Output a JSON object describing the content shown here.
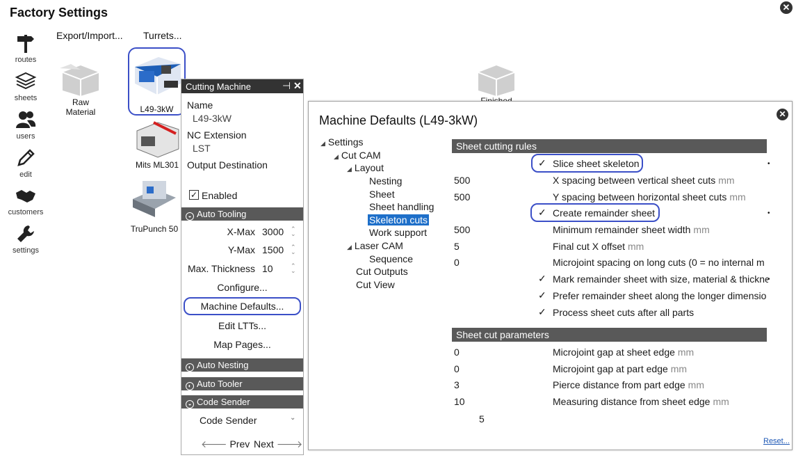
{
  "app": {
    "title": "Factory Settings",
    "close_icon": "close-icon"
  },
  "toplinks": {
    "export": "Export/Import...",
    "turrets": "Turrets..."
  },
  "nav": [
    {
      "label": "routes",
      "icon": "signpost-icon"
    },
    {
      "label": "sheets",
      "icon": "layers-icon"
    },
    {
      "label": "users",
      "icon": "users-icon"
    },
    {
      "label": "edit",
      "icon": "pencil-icon"
    },
    {
      "label": "customers",
      "icon": "handshake-icon"
    },
    {
      "label": "settings",
      "icon": "wrench-icon"
    }
  ],
  "canvas": {
    "raw_material": "Raw\nMaterial",
    "l49": "L49-3kW",
    "mits": "Mits ML301",
    "trupunch": "TruPunch 50",
    "finished": "Finished"
  },
  "panel": {
    "title": "Cutting Machine",
    "name_label": "Name",
    "name_value": "L49-3kW",
    "nc_label": "NC Extension",
    "nc_value": "LST",
    "output_label": "Output Destination",
    "enabled_label": "Enabled",
    "enabled": true,
    "auto_tooling": "Auto Tooling",
    "xmax_label": "X-Max",
    "xmax_value": "3000",
    "ymax_label": "Y-Max",
    "ymax_value": "1500",
    "thick_label": "Max. Thickness",
    "thick_value": "10",
    "configure": "Configure...",
    "machine_defaults": "Machine Defaults...",
    "edit_ltts": "Edit LTTs...",
    "map_pages": "Map Pages...",
    "auto_nesting": "Auto Nesting",
    "auto_tooler": "Auto Tooler",
    "code_sender_section": "Code Sender",
    "code_sender_select": "Code Sender",
    "prev": "Prev",
    "next": "Next"
  },
  "dialog": {
    "title": "Machine Defaults (L49-3kW)",
    "tree": [
      {
        "label": "Settings",
        "expander": "◢"
      },
      {
        "label": "Cut CAM",
        "expander": "◢"
      },
      {
        "label": "Layout",
        "expander": "◢"
      },
      {
        "label": "Nesting"
      },
      {
        "label": "Sheet"
      },
      {
        "label": "Sheet handling"
      },
      {
        "label": "Skeleton cuts",
        "selected": true
      },
      {
        "label": "Work support"
      },
      {
        "label": "Laser CAM",
        "expander": "◢"
      },
      {
        "label": "Sequence"
      },
      {
        "label": "Cut Outputs"
      },
      {
        "label": "Cut View"
      }
    ],
    "section1": "Sheet cutting rules",
    "rules": [
      {
        "value": "",
        "check": "✓",
        "label": "Slice sheet skeleton",
        "unit": ""
      },
      {
        "value": "500",
        "check": "",
        "label": "X spacing between vertical sheet cuts",
        "unit": "mm"
      },
      {
        "value": "500",
        "check": "",
        "label": "Y spacing between horizontal sheet cuts",
        "unit": "mm"
      },
      {
        "value": "",
        "check": "✓",
        "label": "Create remainder sheet",
        "unit": ""
      },
      {
        "value": "500",
        "check": "",
        "label": "Minimum remainder sheet width",
        "unit": "mm"
      },
      {
        "value": "5",
        "check": "",
        "label": "Final cut X offset",
        "unit": "mm"
      },
      {
        "value": "0",
        "check": "",
        "label": "Microjoint spacing on long cuts (0 = no internal m",
        "unit": ""
      },
      {
        "value": "",
        "check": "✓",
        "label": "Mark remainder sheet with size, material & thickne",
        "unit": ""
      },
      {
        "value": "",
        "check": "✓",
        "label": "Prefer remainder sheet along the longer dimensio",
        "unit": ""
      },
      {
        "value": "",
        "check": "✓",
        "label": "Process sheet cuts after all parts",
        "unit": ""
      }
    ],
    "section2": "Sheet cut parameters",
    "params": [
      {
        "value": "0",
        "label": "Microjoint gap at sheet edge",
        "unit": "mm"
      },
      {
        "value": "0",
        "label": "Microjoint gap at part edge",
        "unit": "mm"
      },
      {
        "value": "3",
        "label": "Pierce distance from part edge",
        "unit": "mm"
      },
      {
        "value": "10",
        "label": "Measuring distance from sheet edge",
        "unit": "mm"
      }
    ],
    "extra_value": "5",
    "reset": "Reset..."
  },
  "colors": {
    "section": "#595959",
    "selection": "#1e6fc9",
    "highlight": "#3b4fc7"
  }
}
